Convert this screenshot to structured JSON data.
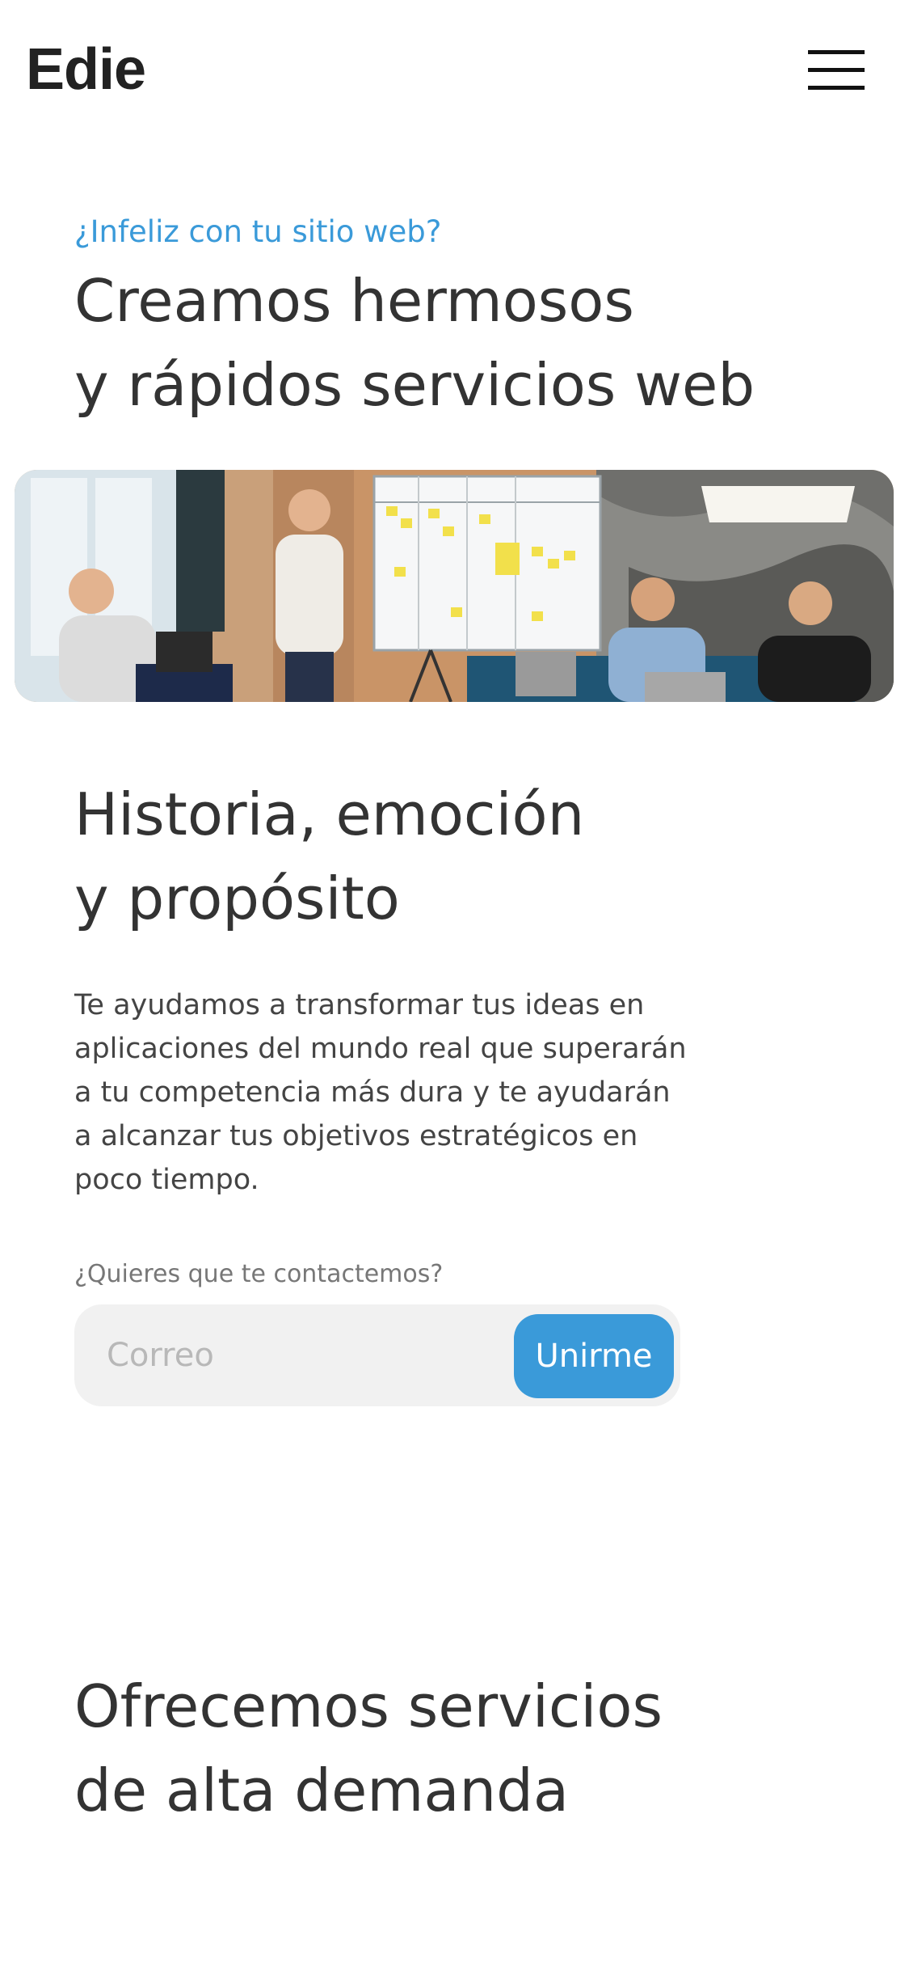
{
  "header": {
    "logo": "Edie",
    "menu_icon": "hamburger-menu-icon"
  },
  "hero": {
    "eyebrow": "¿Infeliz con tu sitio web?",
    "title_lines": [
      "Creamos hermosos",
      "y rápidos servicios web"
    ],
    "image_alt": "team-meeting-photo"
  },
  "about": {
    "title_lines": [
      "Historia, emoción",
      "y propósito"
    ],
    "body": "Te ayudamos a transformar tus ideas en aplicaciones del mundo real que superarán a tu competencia más dura y te ayudarán a alcanzar tus objetivos estratégicos en poco tiempo.",
    "contact_label": "¿Quieres que te contactemos?",
    "email_placeholder": "Correo",
    "email_value": "",
    "join_label": "Unirme"
  },
  "services": {
    "title_lines": [
      "Ofrecemos servicios",
      "de alta demanda"
    ]
  },
  "colors": {
    "accent": "#3a9ad9",
    "text": "#333333",
    "input_bg": "#f1f1f1"
  }
}
